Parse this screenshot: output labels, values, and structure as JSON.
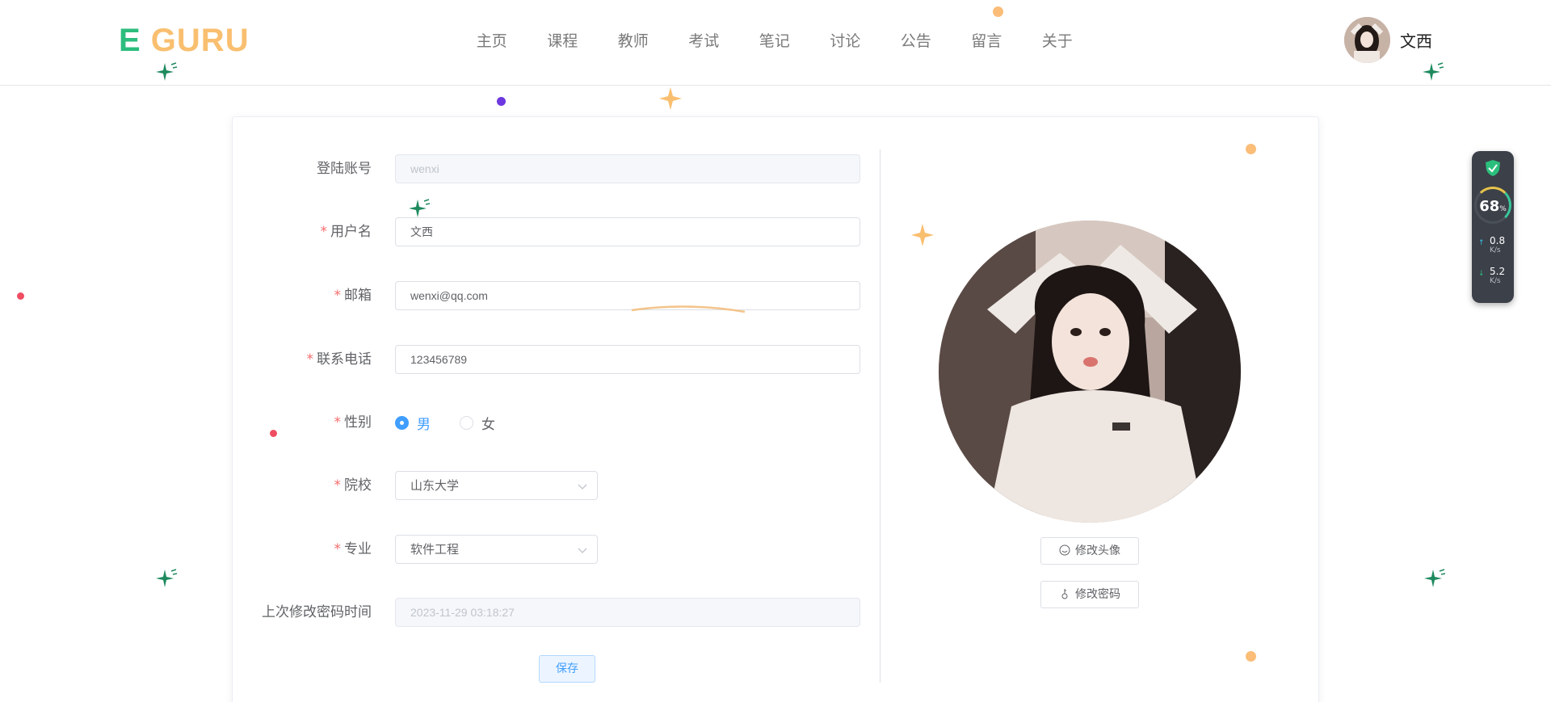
{
  "header": {
    "logo_e": "E",
    "logo_guru": " GURU",
    "nav": [
      "主页",
      "课程",
      "教师",
      "考试",
      "笔记",
      "讨论",
      "公告",
      "留言",
      "关于"
    ],
    "user_name": "文西"
  },
  "form": {
    "account": {
      "label": "登陆账号",
      "value": "wenxi"
    },
    "username": {
      "label": "用户名",
      "value": "文西"
    },
    "email": {
      "label": "邮箱",
      "value": "wenxi@qq.com"
    },
    "phone": {
      "label": "联系电话",
      "value": "123456789"
    },
    "gender": {
      "label": "性别",
      "options": [
        "男",
        "女"
      ],
      "selected": "男"
    },
    "school": {
      "label": "院校",
      "value": "山东大学"
    },
    "major": {
      "label": "专业",
      "value": "软件工程"
    },
    "last_pwd_change": {
      "label": "上次修改密码时间",
      "value": "2023-11-29 03:18:27"
    },
    "required_mark": "*",
    "save_label": "保存"
  },
  "profile": {
    "change_avatar_label": "修改头像",
    "change_password_label": "修改密码"
  },
  "widget": {
    "percent": "68",
    "percent_unit": "%",
    "up_speed": "0.8",
    "down_speed": "5.2",
    "speed_unit": "K/s"
  },
  "colors": {
    "accent": "#409eff",
    "required": "#f56c6c",
    "logo_green": "#2dbd7e",
    "logo_orange": "#f9bf70"
  }
}
